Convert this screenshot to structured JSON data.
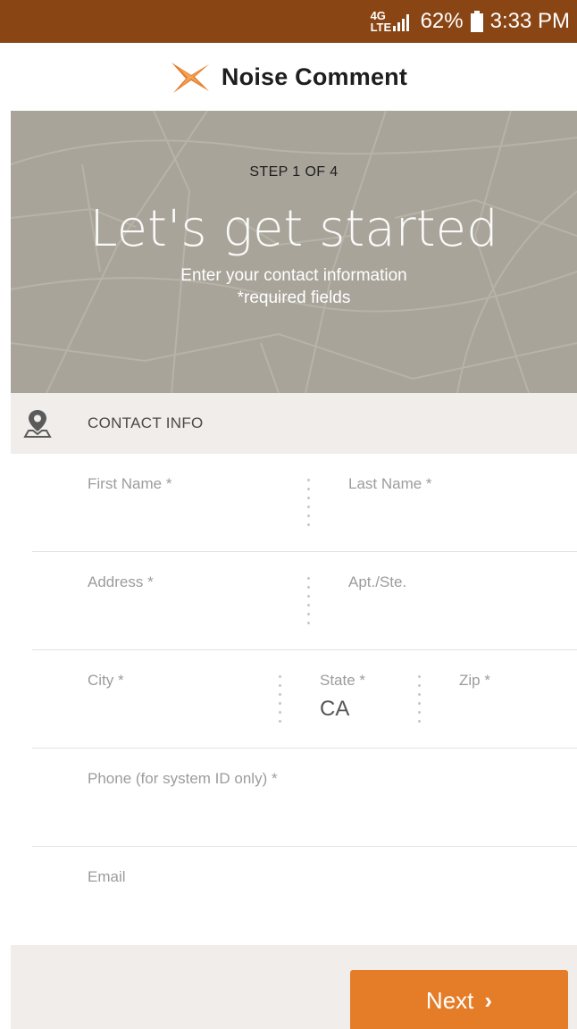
{
  "status_bar": {
    "network_type": "4G LTE",
    "battery": "62%",
    "time": "3:33 PM"
  },
  "header": {
    "title": "Noise Comment"
  },
  "hero": {
    "step": "STEP 1 OF 4",
    "headline": "Let's get started",
    "subtitle_line1": "Enter your contact information",
    "subtitle_line2": "*required fields"
  },
  "section": {
    "label": "CONTACT INFO"
  },
  "form": {
    "first_name_label": "First Name *",
    "last_name_label": "Last Name *",
    "address_label": "Address *",
    "apt_label": "Apt./Ste.",
    "city_label": "City *",
    "state_label": "State *",
    "state_value": "CA",
    "zip_label": "Zip *",
    "phone_label": "Phone (for system ID only) *",
    "email_label": "Email"
  },
  "footer": {
    "next_label": "Next",
    "next_icon": "chevron-right-icon"
  },
  "colors": {
    "status_bar": "#8a4514",
    "accent": "#e57c28",
    "hero_bg": "#a8a49a",
    "section_bg": "#f0edea"
  }
}
